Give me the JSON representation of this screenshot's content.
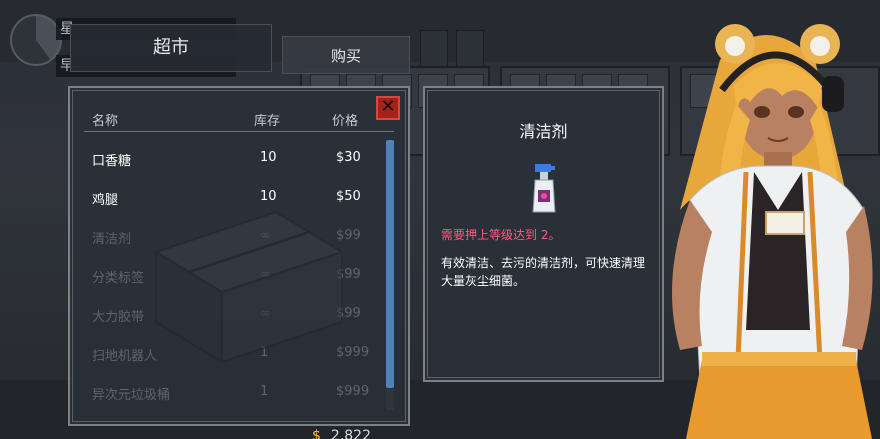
{
  "hud": {
    "line1": "星",
    "line2": "早"
  },
  "tabs": {
    "market": "超市",
    "buy": "购买"
  },
  "list": {
    "columns": {
      "name": "名称",
      "stock": "库存",
      "price": "价格"
    },
    "close_label": "✕",
    "items": [
      {
        "name": "口香糖",
        "stock": "10",
        "price": "$30"
      },
      {
        "name": "鸡腿",
        "stock": "10",
        "price": "$50"
      },
      {
        "name": "清洁剂",
        "stock": "∞",
        "price": "$99"
      },
      {
        "name": "分类标签",
        "stock": "∞",
        "price": "$99"
      },
      {
        "name": "大力胶带",
        "stock": "∞",
        "price": "$99"
      },
      {
        "name": "扫地机器人",
        "stock": "1",
        "price": "$999"
      },
      {
        "name": "异次元垃圾桶",
        "stock": "1",
        "price": "$999"
      }
    ],
    "scroll_fraction": 0.92
  },
  "detail": {
    "title": "清洁剂",
    "icon": "spray-bottle-icon",
    "requirement": "需要押上等级达到 2。",
    "description": "有效清洁、去污的清洁剂，可快速清理大量灰尘细菌。"
  },
  "money": {
    "currency": "$",
    "amount": "2,822"
  },
  "colors": {
    "panel_bg": "#2a3037",
    "panel_border": "#7a8189",
    "accent_scroll": "#4e82bf",
    "requirement_text": "#ff5a86",
    "close_button": "#a3231c"
  }
}
